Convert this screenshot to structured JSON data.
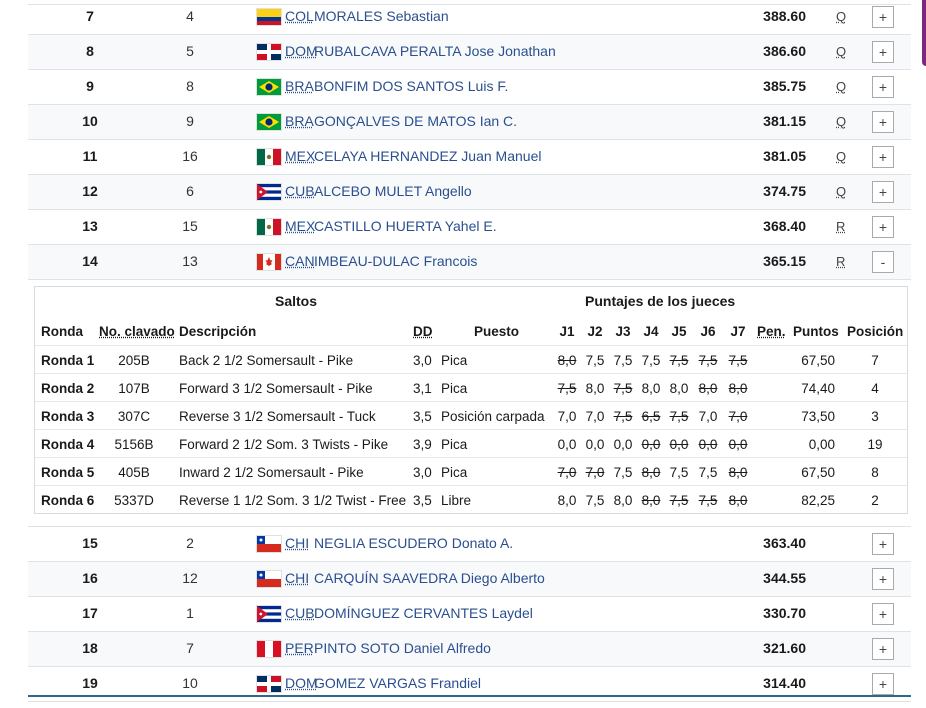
{
  "top_rows": [
    {
      "rank": "7",
      "num": "4",
      "flag": "col",
      "country": "COL",
      "name": "MORALES Sebastian",
      "score": "388.60",
      "q": "Q",
      "toggle": "+"
    },
    {
      "rank": "8",
      "num": "5",
      "flag": "dom",
      "country": "DOM",
      "name": "RUBALCAVA PERALTA Jose Jonathan",
      "score": "386.60",
      "q": "Q",
      "toggle": "+"
    },
    {
      "rank": "9",
      "num": "8",
      "flag": "bra",
      "country": "BRA",
      "name": "BONFIM DOS SANTOS Luis F.",
      "score": "385.75",
      "q": "Q",
      "toggle": "+"
    },
    {
      "rank": "10",
      "num": "9",
      "flag": "bra",
      "country": "BRA",
      "name": "GONÇALVES DE MATOS Ian C.",
      "score": "381.15",
      "q": "Q",
      "toggle": "+"
    },
    {
      "rank": "11",
      "num": "16",
      "flag": "mex",
      "country": "MEX",
      "name": "CELAYA HERNANDEZ Juan Manuel",
      "score": "381.05",
      "q": "Q",
      "toggle": "+"
    },
    {
      "rank": "12",
      "num": "6",
      "flag": "cub",
      "country": "CUB",
      "name": "ALCEBO MULET Angello",
      "score": "374.75",
      "q": "Q",
      "toggle": "+"
    },
    {
      "rank": "13",
      "num": "15",
      "flag": "mex",
      "country": "MEX",
      "name": "CASTILLO HUERTA Yahel E.",
      "score": "368.40",
      "q": "R",
      "toggle": "+"
    },
    {
      "rank": "14",
      "num": "13",
      "flag": "can",
      "country": "CAN",
      "name": "IMBEAU-DULAC Francois",
      "score": "365.15",
      "q": "R",
      "toggle": "-"
    }
  ],
  "detail": {
    "headers": {
      "saltos": "Saltos",
      "puntajes": "Puntajes de los jueces",
      "ronda": "Ronda",
      "clavado": "No. clavado",
      "descripcion": "Descripción",
      "dd": "DD",
      "puesto": "Puesto",
      "j1": "J1",
      "j2": "J2",
      "j3": "J3",
      "j4": "J4",
      "j5": "J5",
      "j6": "J6",
      "j7": "J7",
      "pen": "Pen.",
      "puntos": "Puntos",
      "posicion": "Posición"
    },
    "rounds": [
      {
        "ronda": "Ronda 1",
        "clavado": "205B",
        "desc": "Back 2 1/2 Somersault - Pike",
        "dd": "3,0",
        "puesto": "Pica",
        "judges": [
          "8,0",
          "7,5",
          "7,5",
          "7,5",
          "7,5",
          "7,5",
          "7,5"
        ],
        "struck": [
          true,
          false,
          false,
          false,
          true,
          true,
          true
        ],
        "pen": "",
        "puntos": "67,50",
        "pos": "7"
      },
      {
        "ronda": "Ronda 2",
        "clavado": "107B",
        "desc": "Forward 3 1/2 Somersault - Pike",
        "dd": "3,1",
        "puesto": "Pica",
        "judges": [
          "7,5",
          "8,0",
          "7,5",
          "8,0",
          "8,0",
          "8,0",
          "8,0"
        ],
        "struck": [
          true,
          false,
          true,
          false,
          false,
          true,
          true
        ],
        "pen": "",
        "puntos": "74,40",
        "pos": "4"
      },
      {
        "ronda": "Ronda 3",
        "clavado": "307C",
        "desc": "Reverse 3 1/2 Somersault - Tuck",
        "dd": "3,5",
        "puesto": "Posición carpada",
        "judges": [
          "7,0",
          "7,0",
          "7,5",
          "6,5",
          "7,5",
          "7,0",
          "7,0"
        ],
        "struck": [
          false,
          false,
          true,
          true,
          true,
          false,
          true
        ],
        "pen": "",
        "puntos": "73,50",
        "pos": "3"
      },
      {
        "ronda": "Ronda 4",
        "clavado": "5156B",
        "desc": "Forward 2 1/2 Som. 3 Twists - Pike",
        "dd": "3,9",
        "puesto": "Pica",
        "judges": [
          "0,0",
          "0,0",
          "0,0",
          "0,0",
          "0,0",
          "0,0",
          "0,0"
        ],
        "struck": [
          false,
          false,
          false,
          true,
          true,
          true,
          true
        ],
        "pen": "",
        "puntos": "0,00",
        "pos": "19"
      },
      {
        "ronda": "Ronda 5",
        "clavado": "405B",
        "desc": "Inward 2 1/2 Somersault - Pike",
        "dd": "3,0",
        "puesto": "Pica",
        "judges": [
          "7,0",
          "7,0",
          "7,5",
          "8,0",
          "7,5",
          "7,5",
          "8,0"
        ],
        "struck": [
          true,
          true,
          false,
          true,
          false,
          false,
          true
        ],
        "pen": "",
        "puntos": "67,50",
        "pos": "8"
      },
      {
        "ronda": "Ronda 6",
        "clavado": "5337D",
        "desc": "Reverse 1 1/2 Som. 3 1/2 Twist - Free",
        "dd": "3,5",
        "puesto": "Libre",
        "judges": [
          "8,0",
          "7,5",
          "8,0",
          "8,0",
          "7,5",
          "7,5",
          "8,0"
        ],
        "struck": [
          false,
          false,
          false,
          true,
          true,
          true,
          true
        ],
        "pen": "",
        "puntos": "82,25",
        "pos": "2"
      }
    ]
  },
  "bottom_rows": [
    {
      "rank": "15",
      "num": "2",
      "flag": "chi",
      "country": "CHI",
      "name": "NEGLIA ESCUDERO Donato A.",
      "score": "363.40",
      "q": "",
      "toggle": "+"
    },
    {
      "rank": "16",
      "num": "12",
      "flag": "chi",
      "country": "CHI",
      "name": "CARQUÍN SAAVEDRA Diego Alberto",
      "score": "344.55",
      "q": "",
      "toggle": "+"
    },
    {
      "rank": "17",
      "num": "1",
      "flag": "cub",
      "country": "CUB",
      "name": "DOMÍNGUEZ CERVANTES Laydel",
      "score": "330.70",
      "q": "",
      "toggle": "+"
    },
    {
      "rank": "18",
      "num": "7",
      "flag": "per",
      "country": "PER",
      "name": "PINTO SOTO Daniel Alfredo",
      "score": "321.60",
      "q": "",
      "toggle": "+"
    },
    {
      "rank": "19",
      "num": "10",
      "flag": "dom",
      "country": "DOM",
      "name": "GOMEZ VARGAS Frandiel",
      "score": "314.40",
      "q": "",
      "toggle": "+"
    }
  ],
  "colors": {
    "link": "#2a4f8f",
    "accent": "#7a2a78",
    "rule": "#2d6a8a"
  }
}
